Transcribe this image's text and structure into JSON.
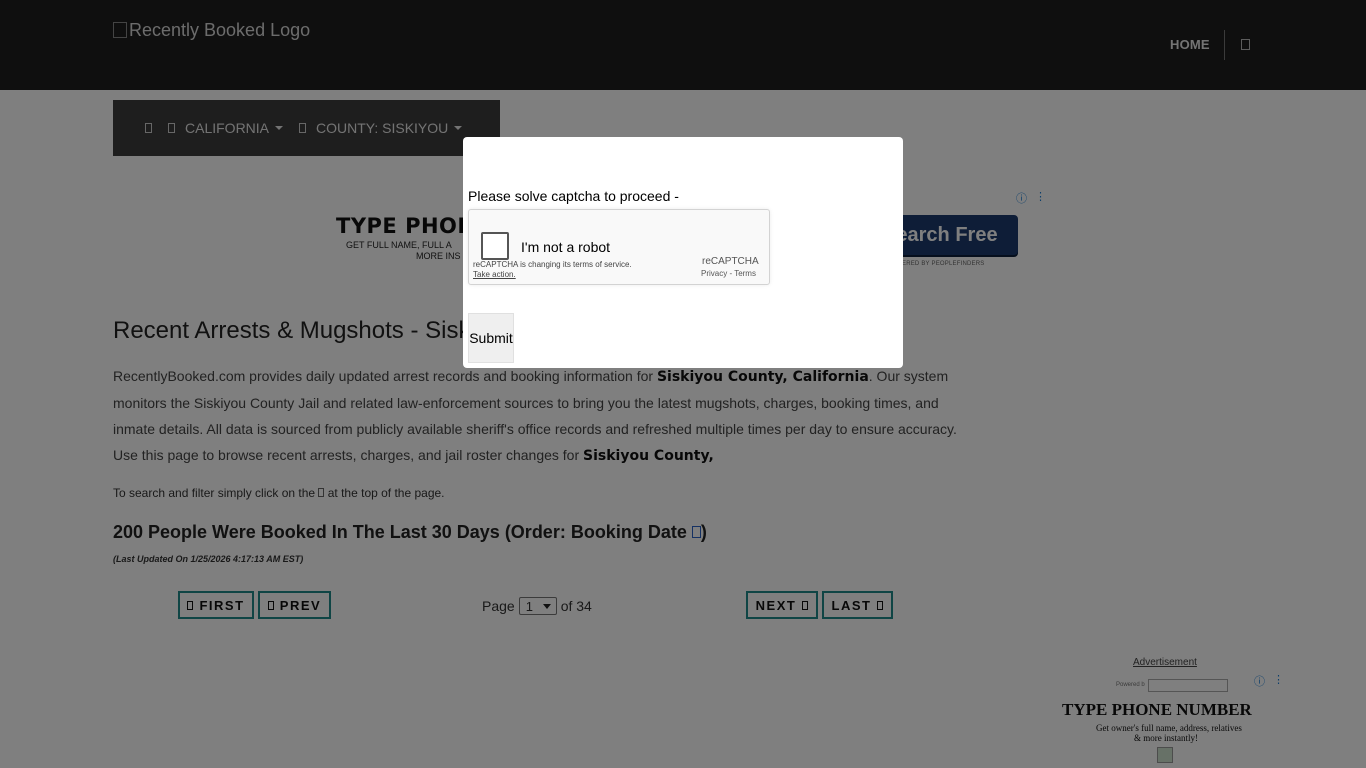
{
  "header": {
    "logo_alt": "Recently Booked Logo",
    "nav_home": "HOME",
    "nav_icon": "menu-icon"
  },
  "breadcrumb": {
    "home_icon": "home-icon",
    "state_label": "CALIFORNIA",
    "county_label": "COUNTY: SISKIYOU"
  },
  "ad_top": {
    "headline": "TYPE PHONE",
    "sub1": "GET FULL NAME, FULL A",
    "sub2": "MORE INS",
    "button_label": "earch Free",
    "powered": "ERED BY PEOPLEFINDERS"
  },
  "main": {
    "title": "Recent Arrests & Mugshots - Sisk",
    "intro_p1": "RecentlyBooked.com provides daily updated arrest records and booking information for ",
    "intro_b1": "Siskiyou County, California",
    "intro_p2": ". Our system monitors the Siskiyou County Jail and related law-enforcement sources to bring you the latest mugshots, charges, booking times, and inmate details. All data is sourced from publicly available sheriff's office records and refreshed multiple times per day to ensure accuracy. Use this page to browse recent arrests, charges, and jail roster changes for ",
    "intro_b2": "Siskiyou County,",
    "hint_before": "To search and filter simply click on the ",
    "hint_after": " at the top of the page.",
    "count_title": "200 People Were Booked In The Last 30 Days (Order: Booking Date ",
    "count_close": ")",
    "updated": "(Last Updated On 1/25/2026 4:17:13 AM EST)"
  },
  "pager": {
    "first": "FIRST",
    "prev": "PREV",
    "next": "NEXT",
    "last": "LAST",
    "page_label": "Page",
    "current_page": "1",
    "of_label": "of 34"
  },
  "ad_right": {
    "label": "Advertisement",
    "powered": "Powered b",
    "headline": "TYPE PHONE NUMBER",
    "sub1": "Get owner's full name, address, relatives",
    "sub2": "& more instantly!"
  },
  "modal": {
    "prompt": "Please solve captcha to proceed -",
    "captcha_label": "I'm not a robot",
    "captcha_notice": "reCAPTCHA is changing its terms of service.",
    "captcha_action": "Take action.",
    "captcha_brand": "reCAPTCHA",
    "captcha_terms": "Privacy - Terms",
    "submit": "Submit"
  }
}
